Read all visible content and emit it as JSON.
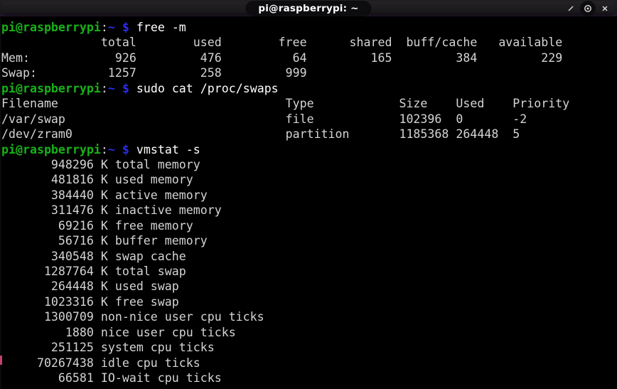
{
  "window": {
    "title": "pi@raspberrypi: ~",
    "buttons": [
      {
        "name": "minimize-button",
        "label": "╱"
      },
      {
        "name": "maximize-button",
        "label": "◉"
      },
      {
        "name": "close-button",
        "label": "✕"
      }
    ]
  },
  "colors": {
    "background": "#000000",
    "foreground": "#d4d4d4",
    "prompt_user": "#18b218",
    "prompt_symbol": "#2a2af0",
    "titlebar": "#1b1a1c"
  },
  "prompt": {
    "user_host": "pi@raspberrypi",
    "colon": ":",
    "path": "~",
    "symbol": "$"
  },
  "session": {
    "commands": [
      {
        "name": "free",
        "command": "free -m",
        "output_lines": [
          "              total        used        free      shared  buff/cache   available",
          "Mem:            926         476          64         165         384         229",
          "Swap:          1257         258         999"
        ],
        "table": {
          "headers": [
            "",
            "total",
            "used",
            "free",
            "shared",
            "buff/cache",
            "available"
          ],
          "rows": [
            [
              "Mem:",
              "926",
              "476",
              "64",
              "165",
              "384",
              "229"
            ],
            [
              "Swap:",
              "1257",
              "258",
              "999",
              "",
              "",
              ""
            ]
          ]
        }
      },
      {
        "name": "cat-proc-swaps",
        "command": "sudo cat /proc/swaps",
        "output_lines": [
          "Filename                                Type            Size    Used    Priority",
          "/var/swap                               file            102396  0       -2",
          "/dev/zram0                              partition       1185368 264448  5"
        ],
        "table": {
          "headers": [
            "Filename",
            "Type",
            "Size",
            "Used",
            "Priority"
          ],
          "rows": [
            [
              "/var/swap",
              "file",
              "102396",
              "0",
              "-2"
            ],
            [
              "/dev/zram0",
              "partition",
              "1185368",
              "264448",
              "5"
            ]
          ]
        }
      },
      {
        "name": "vmstat",
        "command": "vmstat -s",
        "output_lines": [
          "       948296 K total memory",
          "       481816 K used memory",
          "       384440 K active memory",
          "       311476 K inactive memory",
          "        69216 K free memory",
          "        56716 K buffer memory",
          "       340548 K swap cache",
          "      1287764 K total swap",
          "       264448 K used swap",
          "      1023316 K free swap",
          "      1300709 non-nice user cpu ticks",
          "         1880 nice user cpu ticks",
          "       251125 system cpu ticks",
          "     70267438 idle cpu ticks",
          "        66581 IO-wait cpu ticks"
        ],
        "stats": [
          {
            "value": "948296",
            "unit": "K",
            "label": "total memory"
          },
          {
            "value": "481816",
            "unit": "K",
            "label": "used memory"
          },
          {
            "value": "384440",
            "unit": "K",
            "label": "active memory"
          },
          {
            "value": "311476",
            "unit": "K",
            "label": "inactive memory"
          },
          {
            "value": "69216",
            "unit": "K",
            "label": "free memory"
          },
          {
            "value": "56716",
            "unit": "K",
            "label": "buffer memory"
          },
          {
            "value": "340548",
            "unit": "K",
            "label": "swap cache"
          },
          {
            "value": "1287764",
            "unit": "K",
            "label": "total swap"
          },
          {
            "value": "264448",
            "unit": "K",
            "label": "used swap"
          },
          {
            "value": "1023316",
            "unit": "K",
            "label": "free swap"
          },
          {
            "value": "1300709",
            "unit": "",
            "label": "non-nice user cpu ticks"
          },
          {
            "value": "1880",
            "unit": "",
            "label": "nice user cpu ticks"
          },
          {
            "value": "251125",
            "unit": "",
            "label": "system cpu ticks"
          },
          {
            "value": "70267438",
            "unit": "",
            "label": "idle cpu ticks"
          },
          {
            "value": "66581",
            "unit": "",
            "label": "IO-wait cpu ticks"
          }
        ]
      }
    ]
  }
}
